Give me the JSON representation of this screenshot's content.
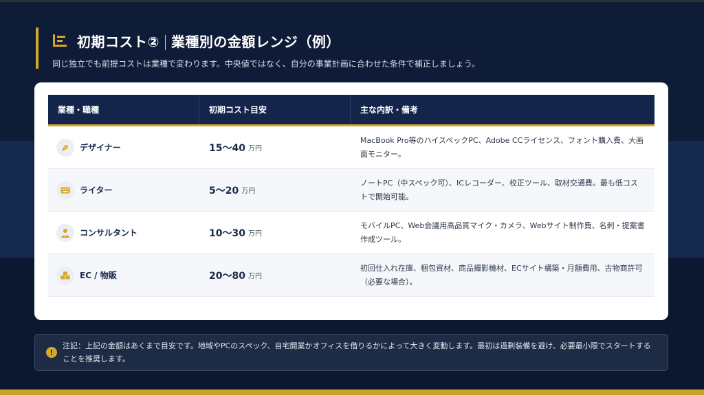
{
  "header": {
    "title_part1": "初期コスト②",
    "title_part2": "業種別の金額レンジ（例）",
    "subtitle": "同じ独立でも前提コストは業種で変わります。中央値ではなく、自分の事業計画に合わせた条件で補正しましょう。",
    "icon": "bar-list-icon"
  },
  "table": {
    "headers": [
      "業種・職種",
      "初期コスト目安",
      "主な内訳・備考"
    ],
    "rows": [
      {
        "role": "デザイナー",
        "icon": "pen-nib-icon",
        "cost": "15〜40",
        "unit": "万円",
        "note": "MacBook Pro等のハイスペックPC、Adobe CCライセンス、フォント購入費、大画面モニター。"
      },
      {
        "role": "ライター",
        "icon": "keyboard-icon",
        "cost": "5〜20",
        "unit": "万円",
        "note": "ノートPC（中スペック可）、ICレコーダー、校正ツール、取材交通費。最も低コストで開始可能。"
      },
      {
        "role": "コンサルタント",
        "icon": "user-tie-icon",
        "cost": "10〜30",
        "unit": "万円",
        "note": "モバイルPC、Web会議用高品質マイク・カメラ、Webサイト制作費、名刺・提案書作成ツール。"
      },
      {
        "role": "EC / 物販",
        "icon": "boxes-icon",
        "cost": "20〜80",
        "unit": "万円",
        "note": "初回仕入れ在庫、梱包資材、商品撮影機材、ECサイト構築・月額費用、古物商許可（必要な場合）。"
      }
    ]
  },
  "notice": {
    "icon": "exclamation-icon",
    "icon_glyph": "!",
    "text": "注記：上記の金額はあくまで目安です。地域やPCのスペック、自宅開業かオフィスを借りるかによって大きく変動します。最初は過剰装備を避け、必要最小限でスタートすることを推奨します。"
  },
  "colors": {
    "accent": "#d4a82a",
    "navy": "#13254a",
    "background": "#0e1a33"
  }
}
